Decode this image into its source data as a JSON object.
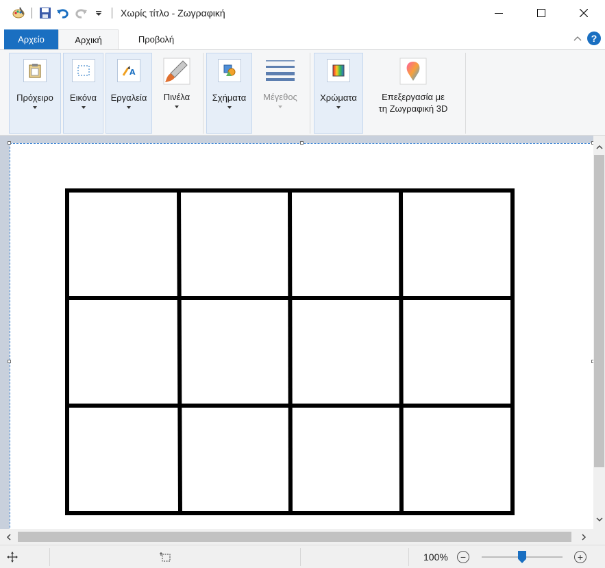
{
  "app": {
    "title": "Χωρίς τίτλο - Ζωγραφική",
    "quick_access": [
      "paint-app-icon",
      "save-icon",
      "undo-icon",
      "redo-icon",
      "customize-qat-icon"
    ],
    "window_controls": [
      "minimize-icon",
      "maximize-icon",
      "close-icon"
    ]
  },
  "tabs": [
    {
      "label": "Αρχείο",
      "active": false,
      "file": true
    },
    {
      "label": "Αρχική",
      "active": true
    },
    {
      "label": "Προβολή",
      "active": false
    }
  ],
  "ribbon": {
    "groups": [
      {
        "id": "clipboard",
        "label": "Πρόχειρο",
        "icon": "clipboard-icon",
        "dropdown": true,
        "enabled": true
      },
      {
        "id": "image",
        "label": "Εικόνα",
        "icon": "selection-icon",
        "dropdown": true,
        "enabled": true
      },
      {
        "id": "tools",
        "label": "Εργαλεία",
        "icon": "tools-icon",
        "dropdown": true,
        "enabled": true
      },
      {
        "id": "brushes",
        "label": "Πινέλα",
        "icon": "brush-icon",
        "dropdown": true,
        "enabled": true
      },
      {
        "id": "shapes",
        "label": "Σχήματα",
        "icon": "shapes-icon",
        "dropdown": true,
        "enabled": true
      },
      {
        "id": "size",
        "label": "Μέγεθος",
        "icon": "line-size-icon",
        "dropdown": true,
        "enabled": false
      },
      {
        "id": "colors",
        "label": "Χρώματα",
        "icon": "color-palette-icon",
        "dropdown": true,
        "enabled": true
      },
      {
        "id": "paint3d",
        "label_line1": "Επεξεργασία με",
        "label_line2": "τη Ζωγραφική 3D",
        "icon": "paint3d-icon",
        "dropdown": false,
        "enabled": true
      }
    ]
  },
  "canvas": {
    "drawing": {
      "shape": "grid",
      "rows": 3,
      "columns": 4,
      "stroke_color": "#000000",
      "fill_color": "#ffffff"
    }
  },
  "statusbar": {
    "move_icon": "move-cursor-icon",
    "selection_icon": "selection-size-icon",
    "zoom_label": "100%",
    "zoom_percent": 100
  },
  "colors": {
    "accent": "#1a6fc1",
    "ribbon_bg": "#f5f6f7",
    "group_highlight": "#e6eef8",
    "workarea_bg": "#c8d0dc"
  }
}
